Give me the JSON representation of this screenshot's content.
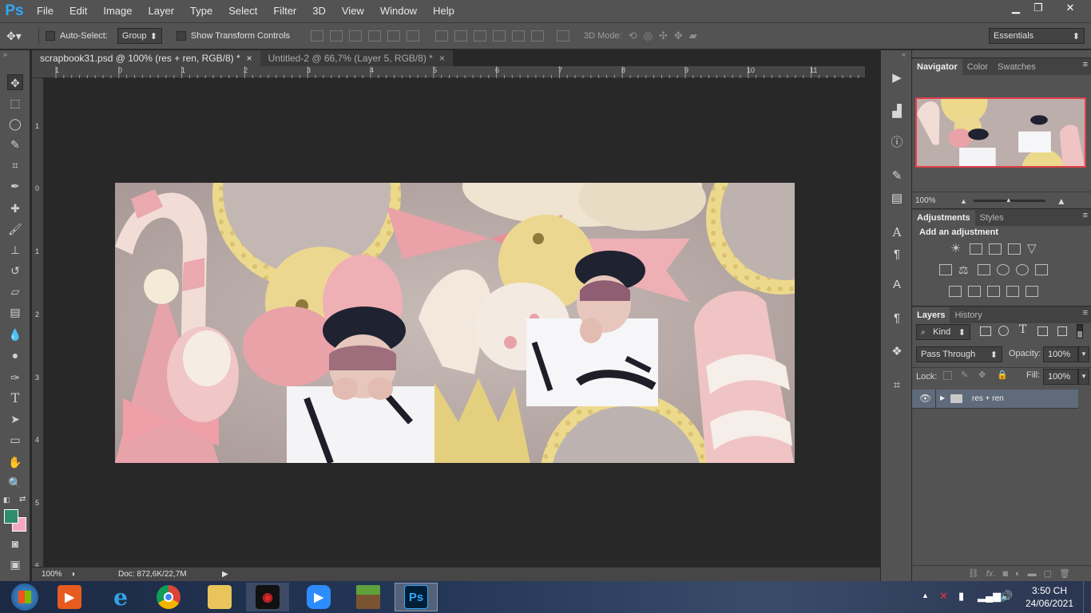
{
  "app": {
    "logo": "Ps",
    "menu": [
      "File",
      "Edit",
      "Image",
      "Layer",
      "Type",
      "Select",
      "Filter",
      "3D",
      "View",
      "Window",
      "Help"
    ],
    "window_controls": {
      "minimize": "▁",
      "restore": "❐",
      "close": "✕"
    }
  },
  "options_bar": {
    "auto_select_label": "Auto-Select:",
    "auto_select_value": "Group",
    "show_transform_label": "Show Transform Controls",
    "mode_3d_label": "3D Mode:",
    "workspace_value": "Essentials"
  },
  "tabs": [
    {
      "label": "scrapbook31.psd @ 100% (res + ren, RGB/8) *",
      "close": "×",
      "active": true
    },
    {
      "label": "Untitled-2 @ 66,7% (Layer 5, RGB/8) *",
      "close": "×",
      "active": false
    }
  ],
  "rulers": {
    "top": [
      "1",
      "0",
      "1",
      "2",
      "3",
      "4",
      "5",
      "6",
      "7",
      "8",
      "9",
      "10",
      "11"
    ],
    "left": [
      "1",
      "0",
      "1",
      "2",
      "3",
      "4",
      "5",
      "6"
    ]
  },
  "status": {
    "zoom": "100%",
    "doc": "Doc: 872,6K/22,7M"
  },
  "navigator": {
    "tabs": [
      "Navigator",
      "Color",
      "Swatches"
    ],
    "zoom": "100%"
  },
  "adjustments": {
    "tabs": [
      "Adjustments",
      "Styles"
    ],
    "heading": "Add an adjustment"
  },
  "layers": {
    "tabs": [
      "Layers",
      "History"
    ],
    "filter_value": "Kind",
    "blend_mode": "Pass Through",
    "opacity_label": "Opacity:",
    "opacity_value": "100%",
    "lock_label": "Lock:",
    "fill_label": "Fill:",
    "fill_value": "100%",
    "items": [
      {
        "name": "res + ren",
        "type": "group",
        "visible": true
      }
    ],
    "footer_icons": [
      "link-icon",
      "fx-icon",
      "mask-icon",
      "adjustment-icon",
      "folder-icon",
      "new-layer-icon",
      "trash-icon"
    ],
    "footer_fx": "fx."
  },
  "taskbar": {
    "clock_time": "3:50 CH",
    "clock_date": "24/06/2021",
    "apps": [
      "start",
      "media-player",
      "internet-explorer",
      "chrome",
      "file-explorer",
      "garena",
      "zoom",
      "minecraft",
      "photoshop"
    ]
  },
  "colors": {
    "foreground": "#2e8b6e",
    "background": "#f4a8c0",
    "ps_blue": "#31a8ff"
  }
}
